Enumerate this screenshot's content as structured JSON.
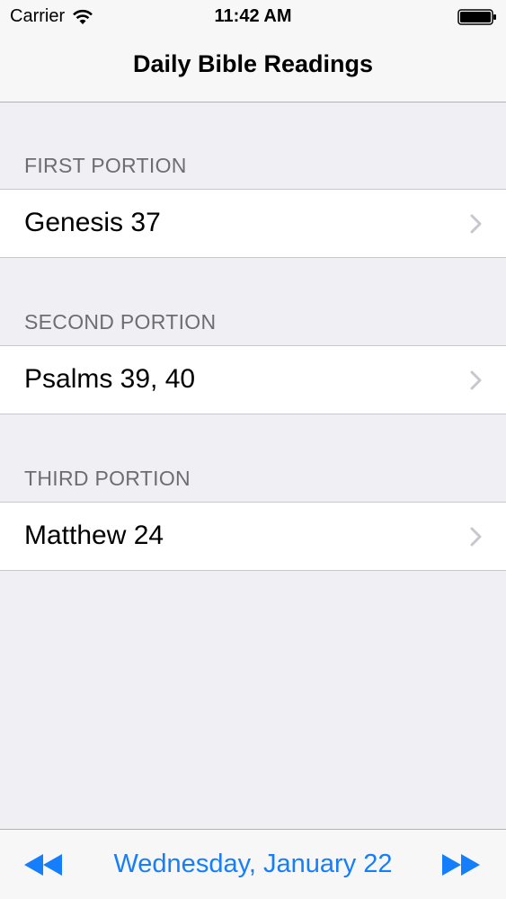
{
  "status_bar": {
    "carrier": "Carrier",
    "time": "11:42 AM",
    "wifi_icon": "wifi-icon",
    "battery_icon": "battery-full-icon"
  },
  "nav": {
    "title": "Daily Bible Readings"
  },
  "sections": [
    {
      "header": "FIRST PORTION",
      "reading": "Genesis 37"
    },
    {
      "header": "SECOND PORTION",
      "reading": "Psalms 39, 40"
    },
    {
      "header": "THIRD PORTION",
      "reading": "Matthew 24"
    }
  ],
  "toolbar": {
    "date": "Wednesday, January 22",
    "prev_icon": "rewind-icon",
    "next_icon": "fast-forward-icon"
  },
  "colors": {
    "accent": "#157efb",
    "background": "#efeff4",
    "section_header": "#6d6d72",
    "chevron": "#c7c7cc"
  }
}
